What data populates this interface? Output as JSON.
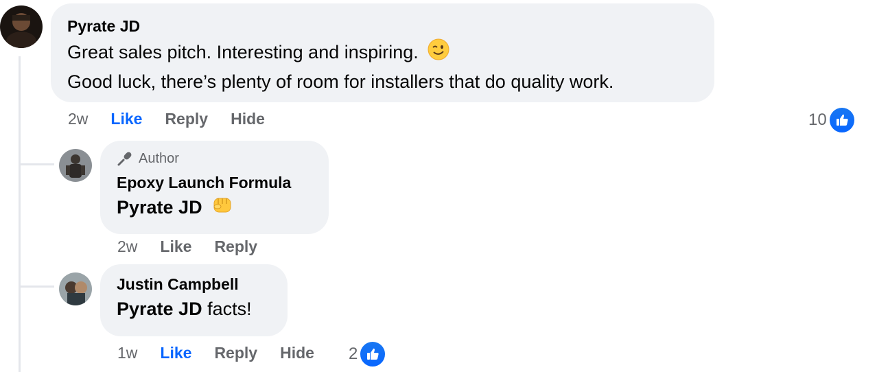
{
  "comments": [
    {
      "author": "Pyrate JD",
      "lines": [
        "Great sales pitch. Interesting and inspiring.",
        "Good luck, there’s plenty of room for installers that do quality work."
      ],
      "emoji": "wink-emoji",
      "time": "2w",
      "like_label": "Like",
      "reply_label": "Reply",
      "hide_label": "Hide",
      "reaction_count": "10"
    }
  ],
  "replies": [
    {
      "badge": "Author",
      "author": "Epoxy Launch Formula",
      "mention": "Pyrate JD",
      "text": "",
      "emoji": "fist-emoji",
      "time": "2w",
      "like_label": "Like",
      "reply_label": "Reply"
    },
    {
      "author": "Justin Campbell",
      "mention": "Pyrate JD",
      "text": "facts!",
      "time": "1w",
      "like_label": "Like",
      "reply_label": "Reply",
      "hide_label": "Hide",
      "reaction_count": "2"
    }
  ],
  "colors": {
    "bubble": "#f0f2f5",
    "link_blue": "#0866ff",
    "meta_gray": "#65676b"
  }
}
